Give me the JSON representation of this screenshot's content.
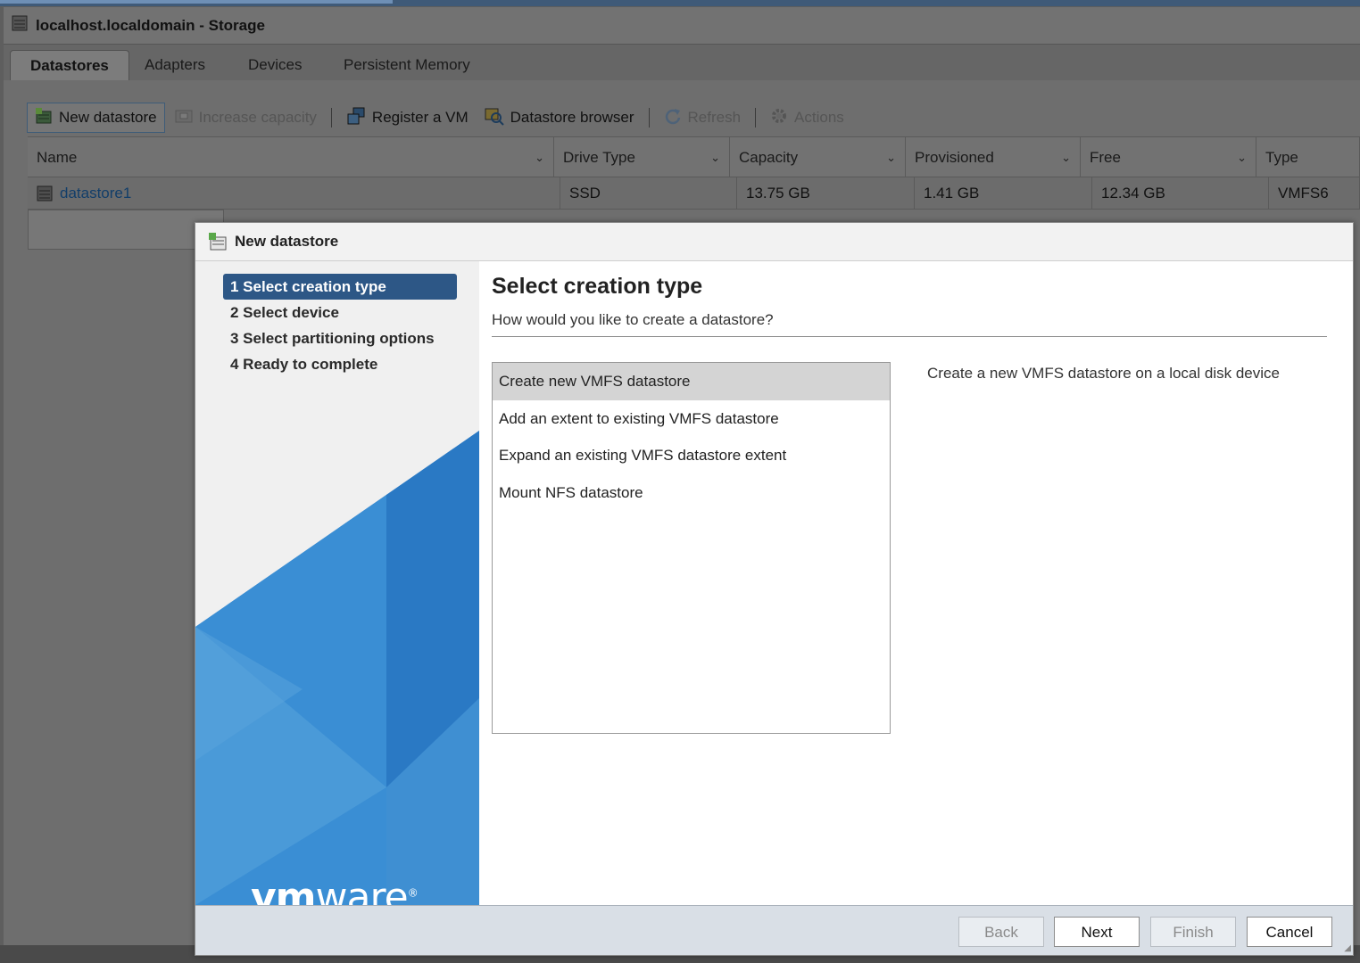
{
  "window": {
    "title": "localhost.localdomain - Storage",
    "icon": "storage-icon"
  },
  "tabs": [
    {
      "label": "Datastores",
      "active": true
    },
    {
      "label": "Adapters",
      "active": false
    },
    {
      "label": "Devices",
      "active": false
    },
    {
      "label": "Persistent Memory",
      "active": false
    }
  ],
  "toolbar": {
    "new_datastore": "New datastore",
    "increase_capacity": "Increase capacity",
    "register_vm": "Register a VM",
    "datastore_browser": "Datastore browser",
    "refresh": "Refresh",
    "actions": "Actions"
  },
  "table": {
    "columns": [
      "Name",
      "Drive Type",
      "Capacity",
      "Provisioned",
      "Free",
      "Type"
    ],
    "rows": [
      {
        "name": "datastore1",
        "drive_type": "SSD",
        "capacity": "13.75 GB",
        "provisioned": "1.41 GB",
        "free": "12.34 GB",
        "type": "VMFS6"
      }
    ]
  },
  "modal": {
    "title": "New datastore",
    "steps": [
      {
        "label": "1  Select creation type",
        "active": true
      },
      {
        "label": "2  Select device",
        "active": false
      },
      {
        "label": "3  Select partitioning options",
        "active": false
      },
      {
        "label": "4  Ready to complete",
        "active": false
      }
    ],
    "heading": "Select creation type",
    "subheading": "How would you like to create a datastore?",
    "options": [
      {
        "label": "Create new VMFS datastore",
        "selected": true
      },
      {
        "label": "Add an extent to existing VMFS datastore",
        "selected": false
      },
      {
        "label": "Expand an existing VMFS datastore extent",
        "selected": false
      },
      {
        "label": "Mount NFS datastore",
        "selected": false
      }
    ],
    "description": "Create a new VMFS datastore on a local disk device",
    "logo": {
      "vm": "vm",
      "ware": "ware",
      "mark": "®"
    },
    "buttons": {
      "back": "Back",
      "next": "Next",
      "finish": "Finish",
      "cancel": "Cancel"
    }
  },
  "colors": {
    "accent": "#2d5786",
    "link": "#123e6a",
    "footer": "#d9dfe6"
  }
}
